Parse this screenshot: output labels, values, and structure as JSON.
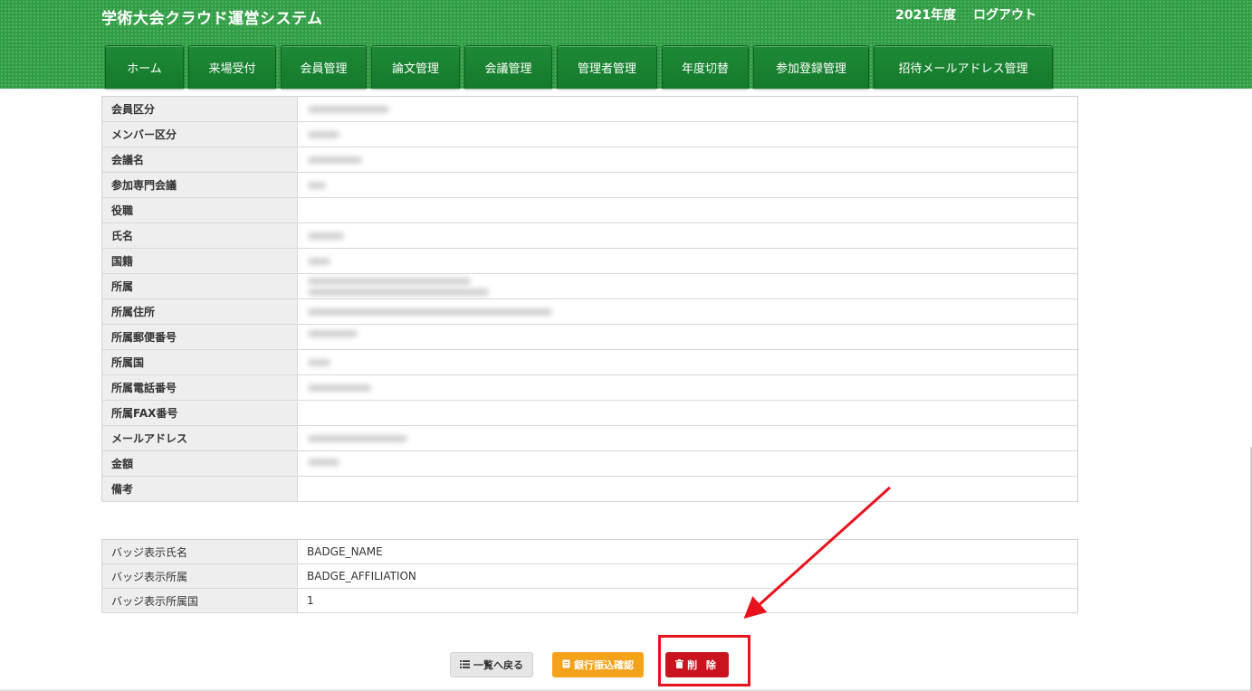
{
  "header": {
    "title": "学術大会クラウド運営システム",
    "year": "2021年度",
    "logout": "ログアウト"
  },
  "tabs": [
    {
      "label": "ホーム"
    },
    {
      "label": "来場受付"
    },
    {
      "label": "会員管理"
    },
    {
      "label": "論文管理"
    },
    {
      "label": "会議管理"
    },
    {
      "label": "管理者管理"
    },
    {
      "label": "年度切替"
    },
    {
      "label": "参加登録管理"
    },
    {
      "label": "招待メールアドレス管理"
    }
  ],
  "member_fields": [
    {
      "label": "会員区分"
    },
    {
      "label": "メンバー区分"
    },
    {
      "label": "会議名"
    },
    {
      "label": "参加専門会議"
    },
    {
      "label": "役職"
    },
    {
      "label": "氏名"
    },
    {
      "label": "国籍"
    },
    {
      "label": "所属"
    },
    {
      "label": "所属住所"
    },
    {
      "label": "所属郵便番号"
    },
    {
      "label": "所属国"
    },
    {
      "label": "所属電話番号"
    },
    {
      "label": "所属FAX番号"
    },
    {
      "label": "メールアドレス"
    },
    {
      "label": "金額"
    },
    {
      "label": "備考"
    }
  ],
  "badge_fields": [
    {
      "label": "バッジ表示氏名",
      "value": "BADGE_NAME"
    },
    {
      "label": "バッジ表示所属",
      "value": "BADGE_AFFILIATION"
    },
    {
      "label": "バッジ表示所属国",
      "value": "1"
    }
  ],
  "buttons": {
    "back": "一覧へ戻る",
    "bank": "銀行振込確認",
    "delete": "削 除"
  },
  "colors": {
    "header_green": "#2f9e44",
    "tab_green": "#137a2b",
    "bank_orange": "#f5a21b",
    "delete_red": "#c9141f",
    "annotation_red": "#e8121c"
  }
}
